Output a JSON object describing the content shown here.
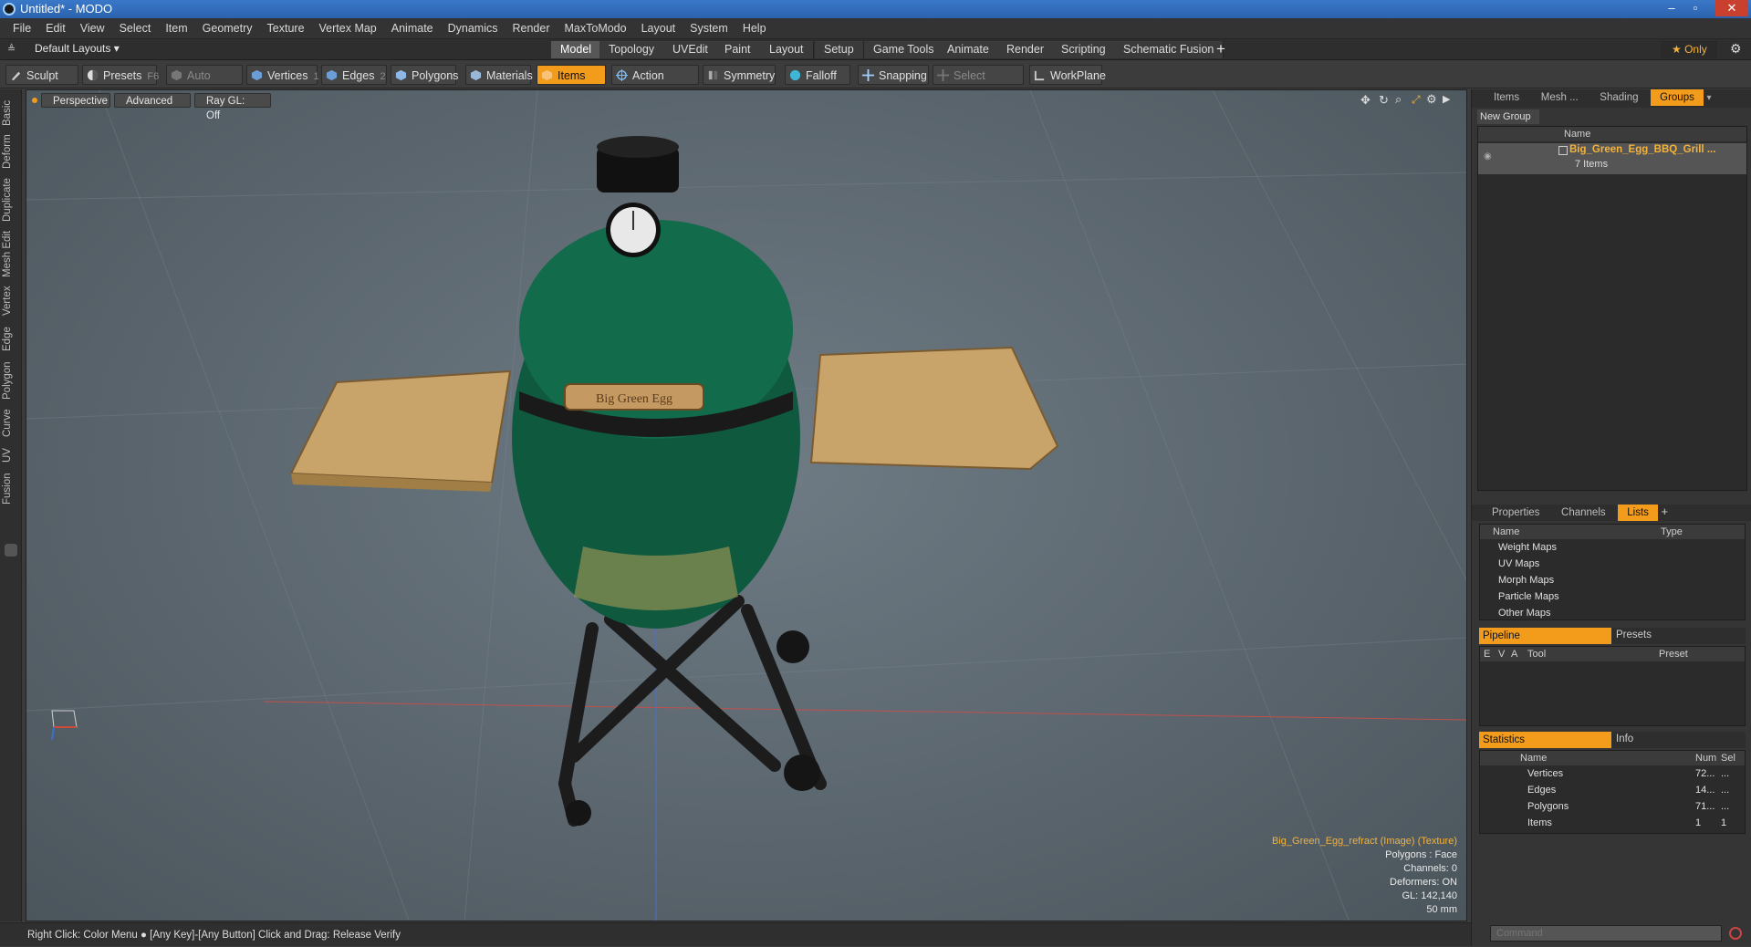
{
  "window": {
    "title": "Untitled* - MODO",
    "min": "–",
    "max": "▫",
    "close": "✕"
  },
  "menu": [
    "File",
    "Edit",
    "View",
    "Select",
    "Item",
    "Geometry",
    "Texture",
    "Vertex Map",
    "Animate",
    "Dynamics",
    "Render",
    "MaxToModo",
    "Layout",
    "System",
    "Help"
  ],
  "layout": {
    "selector": "Default Layouts ▾",
    "tabs": [
      "Model",
      "Topology",
      "UVEdit",
      "Paint",
      "Layout",
      "Setup",
      "Game Tools",
      "Animate",
      "Render",
      "Scripting",
      "Schematic Fusion"
    ],
    "active_tab": "Model",
    "add": "+",
    "only_label": "★ Only",
    "gear": "⚙"
  },
  "toolbar": {
    "sculpt": "Sculpt",
    "presets": "Presets",
    "presets_key": "F6",
    "auto_select": "Auto Select",
    "vertices": "Vertices",
    "vertices_key": "1",
    "edges": "Edges",
    "edges_key": "2",
    "polygons": "Polygons",
    "materials": "Materials",
    "items": "Items",
    "action_center": "Action Center",
    "symmetry": "Symmetry",
    "falloff": "Falloff",
    "snapping": "Snapping",
    "select_through": "Select Through",
    "workplane": "WorkPlane"
  },
  "left_tabs": [
    "Basic",
    "Deform",
    "Duplicate",
    "Mesh Edit",
    "Vertex",
    "Edge",
    "Polygon",
    "Curve",
    "UV",
    "Fusion"
  ],
  "viewport": {
    "view": "Perspective",
    "shading": "Advanced",
    "raygl": "Ray GL: Off",
    "badge_text": "Big Green Egg",
    "hud": [
      "Big_Green_Egg_refract (Image) (Texture)",
      "Polygons : Face",
      "Channels: 0",
      "Deformers: ON",
      "GL: 142,140",
      "50 mm"
    ]
  },
  "status": {
    "text": "Right Click: Color Menu ● [Any Key]-[Any Button] Click and Drag: Release Verify"
  },
  "groups_panel": {
    "tabs": [
      "Items",
      "Mesh ...",
      "Shading",
      "Groups"
    ],
    "active_tab": "Groups",
    "new_group": "New Group",
    "name_header": "Name",
    "group_name": "Big_Green_Egg_BBQ_Grill ...",
    "group_count": "7 Items"
  },
  "lists_panel": {
    "tabs": [
      "Properties",
      "Channels",
      "Lists"
    ],
    "active_tab": "Lists",
    "add": "+",
    "col_name": "Name",
    "col_type": "Type",
    "rows": [
      "Weight Maps",
      "UV Maps",
      "Morph Maps",
      "Particle Maps",
      "Other Maps"
    ]
  },
  "pipeline_panel": {
    "tabs": [
      "Pipeline",
      "Presets"
    ],
    "cols": [
      "E",
      "V",
      "A",
      "Tool",
      "Preset"
    ]
  },
  "stats_panel": {
    "tabs": [
      "Statistics",
      "Info"
    ],
    "cols": [
      "Name",
      "Num",
      "Sel"
    ],
    "rows": [
      {
        "name": "Vertices",
        "num": "72...",
        "sel": "..."
      },
      {
        "name": "Edges",
        "num": "14...",
        "sel": "..."
      },
      {
        "name": "Polygons",
        "num": "71...",
        "sel": "..."
      },
      {
        "name": "Items",
        "num": "1",
        "sel": "1"
      }
    ]
  },
  "command": {
    "placeholder": "Command"
  }
}
